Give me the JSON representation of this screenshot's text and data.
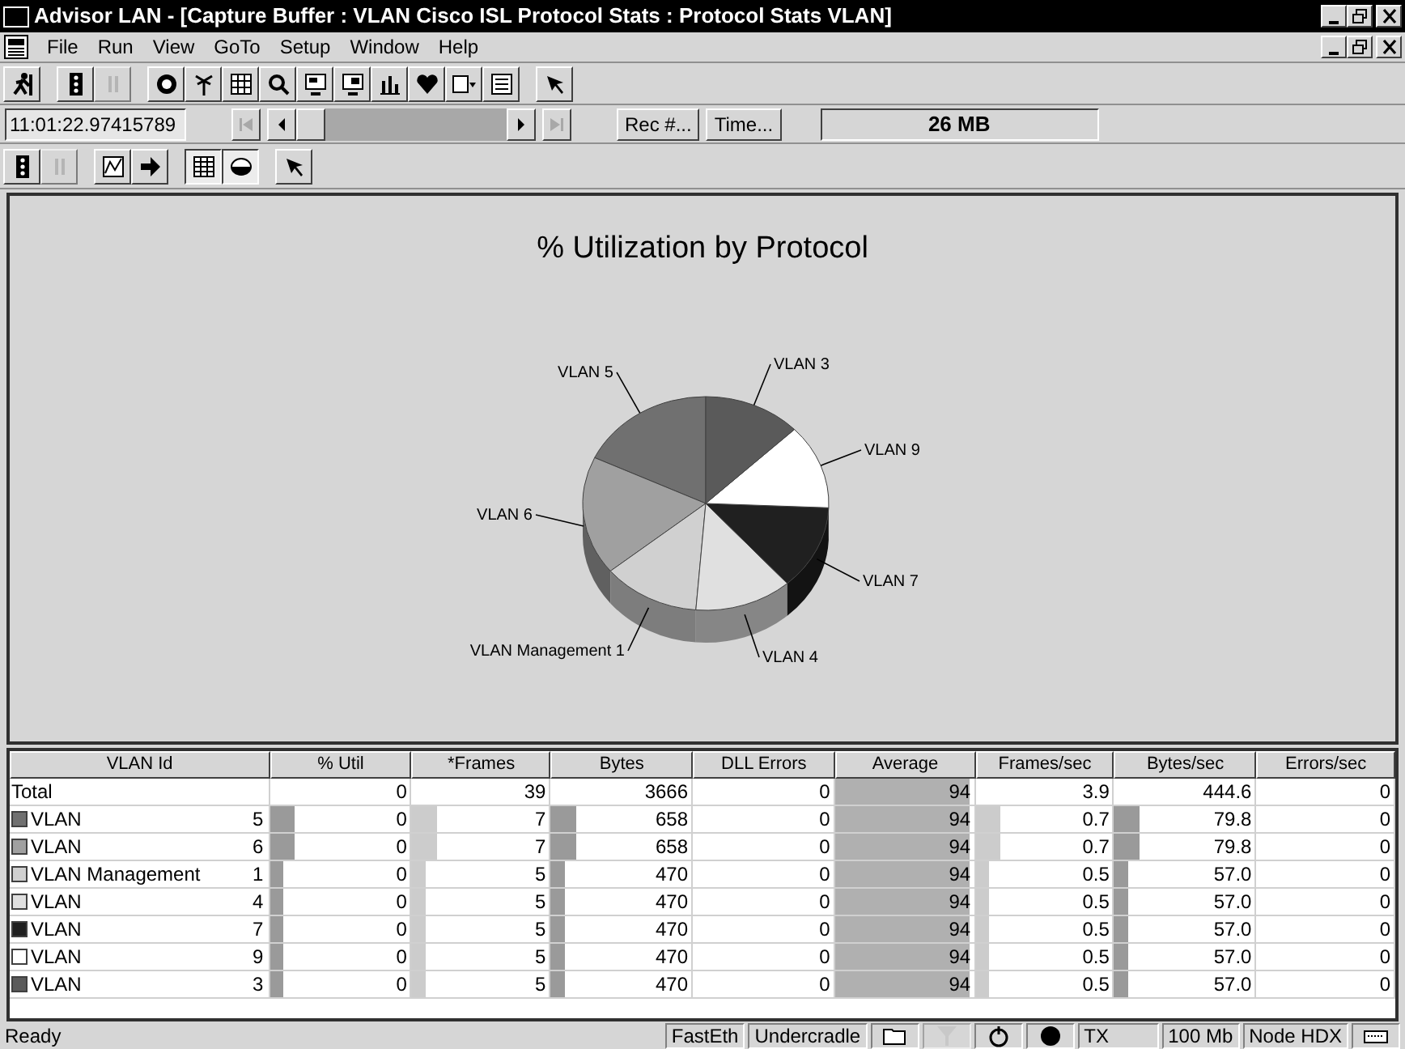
{
  "window": {
    "title": "Advisor LAN - [Capture Buffer : VLAN Cisco ISL Protocol Stats : Protocol Stats VLAN]"
  },
  "menu": [
    "File",
    "Run",
    "View",
    "GoTo",
    "Setup",
    "Window",
    "Help"
  ],
  "toolbar_1": [
    {
      "disabled": false
    },
    {
      "disabled": false
    },
    {
      "disabled": true
    },
    {
      "disabled": false
    },
    {
      "disabled": false
    },
    {
      "disabled": false
    },
    {
      "disabled": false
    },
    {
      "disabled": false
    },
    {
      "disabled": false
    },
    {
      "disabled": false
    },
    {
      "disabled": false
    },
    {
      "disabled": false
    },
    {
      "disabled": false
    },
    {
      "disabled": false
    }
  ],
  "navigation": {
    "time": "11:01:22.97415789",
    "first_disabled": true,
    "last_disabled": true,
    "buttons": [
      "Rec #...",
      "Time..."
    ],
    "buffer_size": "26 MB"
  },
  "toolbar_2": [
    {
      "disabled": false,
      "pressed": false
    },
    {
      "disabled": true,
      "pressed": false
    },
    {
      "disabled": false,
      "pressed": false
    },
    {
      "disabled": false,
      "pressed": false
    },
    {
      "disabled": false,
      "pressed": true
    },
    {
      "disabled": false,
      "pressed": true
    },
    {
      "disabled": false,
      "pressed": false
    }
  ],
  "chart": {
    "title": "% Utilization by Protocol",
    "slice_labels": [
      "VLAN 5",
      "VLAN 6",
      "VLAN Management 1",
      "VLAN 4",
      "VLAN 7",
      "VLAN 9",
      "VLAN 3"
    ]
  },
  "table": {
    "columns": [
      "VLAN Id",
      "% Util",
      "*Frames",
      "Bytes",
      "DLL Errors",
      "Average",
      "Frames/sec",
      "Bytes/sec",
      "Errors/sec"
    ],
    "rows": [
      {
        "name": "Total",
        "cells": [
          {
            "text": "0"
          },
          {
            "text": "39"
          },
          {
            "text": "3666"
          },
          {
            "text": "0"
          },
          {
            "text": "94",
            "level": 0.97
          },
          {
            "text": "3.9"
          },
          {
            "text": "444.6"
          },
          {
            "text": "0"
          }
        ]
      },
      {
        "name": "VLAN",
        "id": "5",
        "color": "#707070",
        "cells": [
          {
            "text": "0",
            "level": 0.18
          },
          {
            "text": "7",
            "level": 0.18
          },
          {
            "text": "658",
            "level": 0.18
          },
          {
            "text": "0"
          },
          {
            "text": "94",
            "level": 0.97
          },
          {
            "text": "0.7",
            "level": 0.18
          },
          {
            "text": "79.8",
            "level": 0.18
          },
          {
            "text": "0"
          }
        ]
      },
      {
        "name": "VLAN",
        "id": "6",
        "color": "#a0a0a0",
        "cells": [
          {
            "text": "0",
            "level": 0.18
          },
          {
            "text": "7",
            "level": 0.18
          },
          {
            "text": "658",
            "level": 0.18
          },
          {
            "text": "0"
          },
          {
            "text": "94",
            "level": 0.97
          },
          {
            "text": "0.7",
            "level": 0.18
          },
          {
            "text": "79.8",
            "level": 0.18
          },
          {
            "text": "0"
          }
        ]
      },
      {
        "name": "VLAN Management",
        "id": "1",
        "color": "#d0d0d0",
        "cells": [
          {
            "text": "0",
            "level": 0.1
          },
          {
            "text": "5",
            "level": 0.1
          },
          {
            "text": "470",
            "level": 0.1
          },
          {
            "text": "0"
          },
          {
            "text": "94",
            "level": 0.97
          },
          {
            "text": "0.5",
            "level": 0.1
          },
          {
            "text": "57.0",
            "level": 0.1
          },
          {
            "text": "0"
          }
        ]
      },
      {
        "name": "VLAN",
        "id": "4",
        "color": "#e0e0e0",
        "cells": [
          {
            "text": "0",
            "level": 0.1
          },
          {
            "text": "5",
            "level": 0.1
          },
          {
            "text": "470",
            "level": 0.1
          },
          {
            "text": "0"
          },
          {
            "text": "94",
            "level": 0.97
          },
          {
            "text": "0.5",
            "level": 0.1
          },
          {
            "text": "57.0",
            "level": 0.1
          },
          {
            "text": "0"
          }
        ]
      },
      {
        "name": "VLAN",
        "id": "7",
        "color": "#202020",
        "cells": [
          {
            "text": "0",
            "level": 0.1
          },
          {
            "text": "5",
            "level": 0.1
          },
          {
            "text": "470",
            "level": 0.1
          },
          {
            "text": "0"
          },
          {
            "text": "94",
            "level": 0.97
          },
          {
            "text": "0.5",
            "level": 0.1
          },
          {
            "text": "57.0",
            "level": 0.1
          },
          {
            "text": "0"
          }
        ]
      },
      {
        "name": "VLAN",
        "id": "9",
        "color": "#ffffff",
        "cells": [
          {
            "text": "0",
            "level": 0.1
          },
          {
            "text": "5",
            "level": 0.1
          },
          {
            "text": "470",
            "level": 0.1
          },
          {
            "text": "0"
          },
          {
            "text": "94",
            "level": 0.97
          },
          {
            "text": "0.5",
            "level": 0.1
          },
          {
            "text": "57.0",
            "level": 0.1
          },
          {
            "text": "0"
          }
        ]
      },
      {
        "name": "VLAN",
        "id": "3",
        "color": "#5a5a5a",
        "cells": [
          {
            "text": "0",
            "level": 0.1
          },
          {
            "text": "5",
            "level": 0.1
          },
          {
            "text": "470",
            "level": 0.1
          },
          {
            "text": "0"
          },
          {
            "text": "94",
            "level": 0.97
          },
          {
            "text": "0.5",
            "level": 0.1
          },
          {
            "text": "57.0",
            "level": 0.1
          },
          {
            "text": "0"
          }
        ]
      }
    ]
  },
  "status_bar": {
    "message": "Ready",
    "panels": [
      {
        "kind": "text",
        "text": "FastEth"
      },
      {
        "kind": "text",
        "text": "Undercradle"
      },
      {
        "kind": "folder"
      },
      {
        "kind": "filter",
        "disabled": true
      },
      {
        "kind": "power"
      },
      {
        "kind": "record"
      },
      {
        "kind": "wide_text",
        "text": "TX"
      },
      {
        "kind": "text",
        "text": "100 Mb"
      },
      {
        "kind": "text",
        "text": "Node HDX"
      },
      {
        "kind": "keyboard"
      }
    ]
  }
}
